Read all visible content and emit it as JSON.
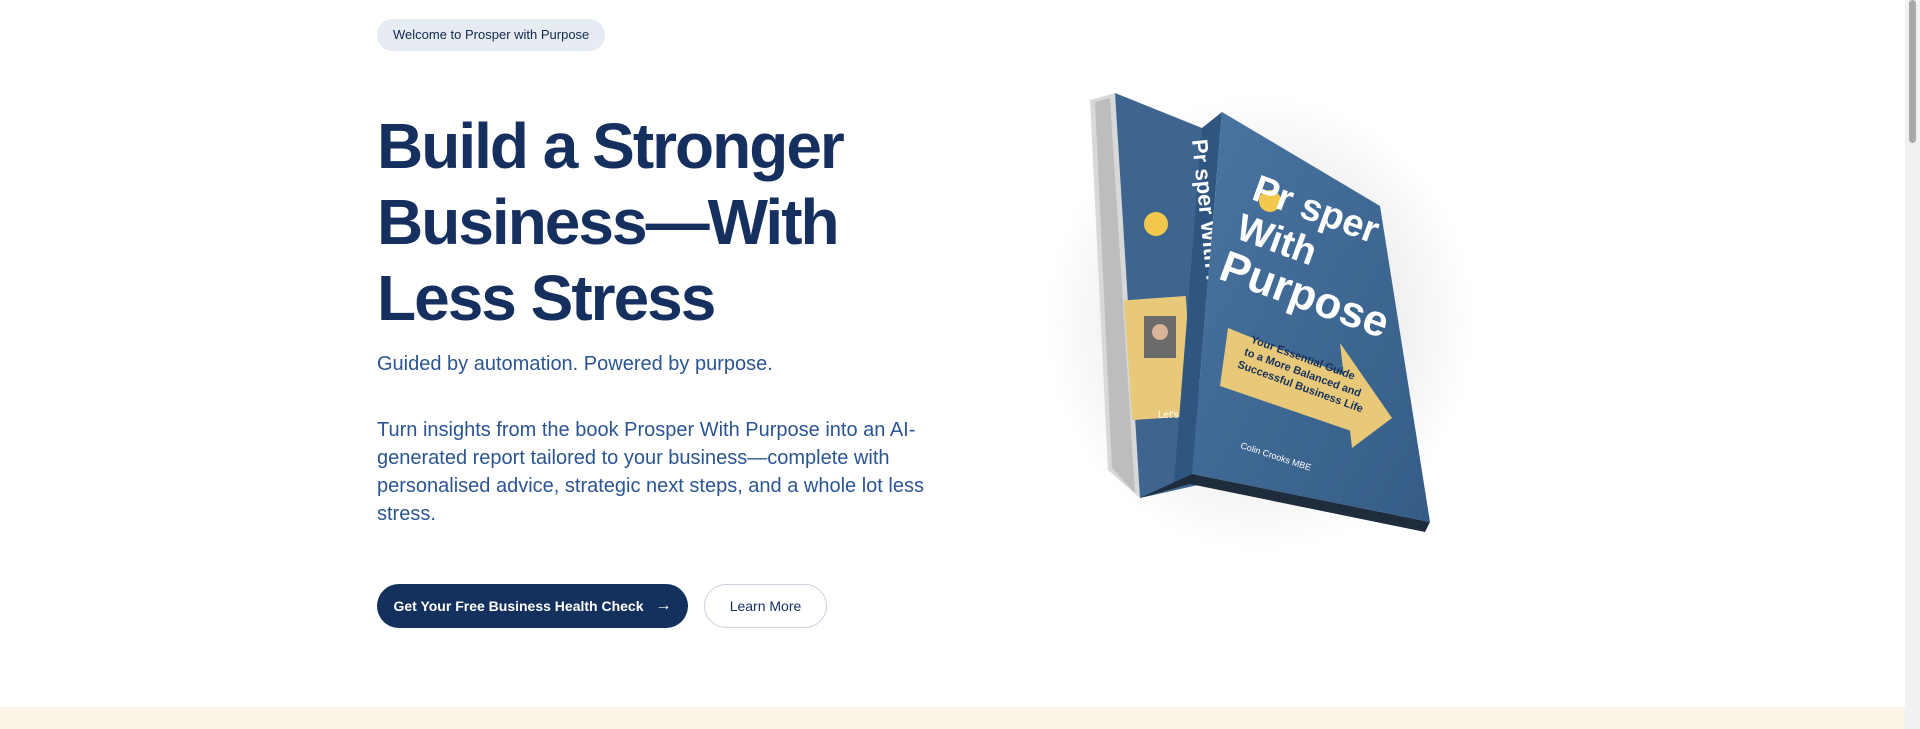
{
  "hero": {
    "badge": "Welcome to Prosper with Purpose",
    "headline": "Build a Stronger Business—With Less Stress",
    "tagline": "Guided by automation. Powered by purpose.",
    "description": "Turn insights from the book Prosper With Purpose into an AI-generated report tailored to your business—complete with personalised advice, strategic next steps, and a whole lot less stress.",
    "primary_button": "Get Your Free Business Health Check",
    "secondary_button": "Learn More"
  },
  "book": {
    "cover_title_line1": "Pr sper",
    "cover_title_line2": "With",
    "cover_title_line3": "Purpose",
    "subtitle_line1": "Your Essential Guide",
    "subtitle_line2": "to a More Balanced and",
    "subtitle_line3": "Successful Business Life",
    "author": "Colin Crooks MBE",
    "spine_title": "Pr sper With Purpose",
    "back_logo": "Let's Tel"
  },
  "colors": {
    "navy": "#14305c",
    "text_blue": "#2b5592",
    "badge_bg": "#e7ebf2",
    "cover_blue": "#3b6591",
    "accent_gold": "#e8c97a",
    "strip_cream": "#fbf3e6"
  },
  "icons": {
    "arrow": "→"
  }
}
